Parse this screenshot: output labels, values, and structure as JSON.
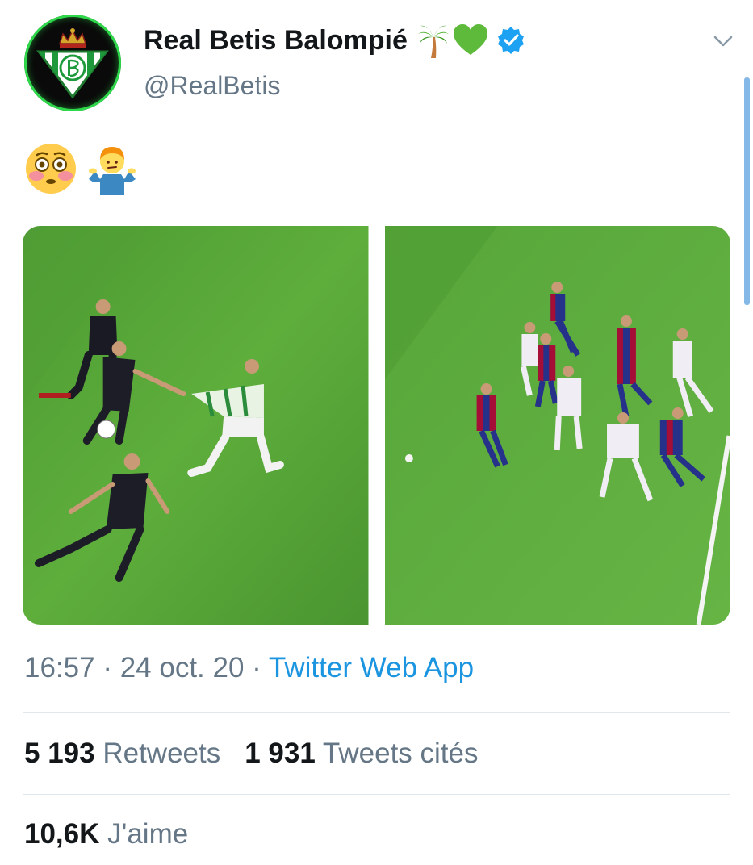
{
  "account": {
    "display_name": "Real Betis Balompié",
    "handle": "@RealBetis",
    "verified": true,
    "name_emoji": [
      "palm-tree-icon",
      "green-heart-icon"
    ]
  },
  "tweet": {
    "emojis": [
      "flushed-face-icon",
      "person-shrugging-icon"
    ],
    "media": [
      "football-photo-betis-shirt-pull",
      "football-photo-barcelona-penalty-area"
    ]
  },
  "meta": {
    "time": "16:57",
    "sep1": " · ",
    "date": "24 oct. 20",
    "sep2": " · ",
    "source": "Twitter Web App"
  },
  "stats": {
    "retweets_count": "5 193",
    "retweets_label": "Retweets",
    "quotes_count": "1 931",
    "quotes_label": "Tweets cités",
    "likes_count": "10,6K",
    "likes_label": "J'aime"
  },
  "colors": {
    "accent": "#1b95e0",
    "secondary_text": "#657786",
    "betis_green": "#2ed84a",
    "pitch_green": "#5ca83a"
  }
}
